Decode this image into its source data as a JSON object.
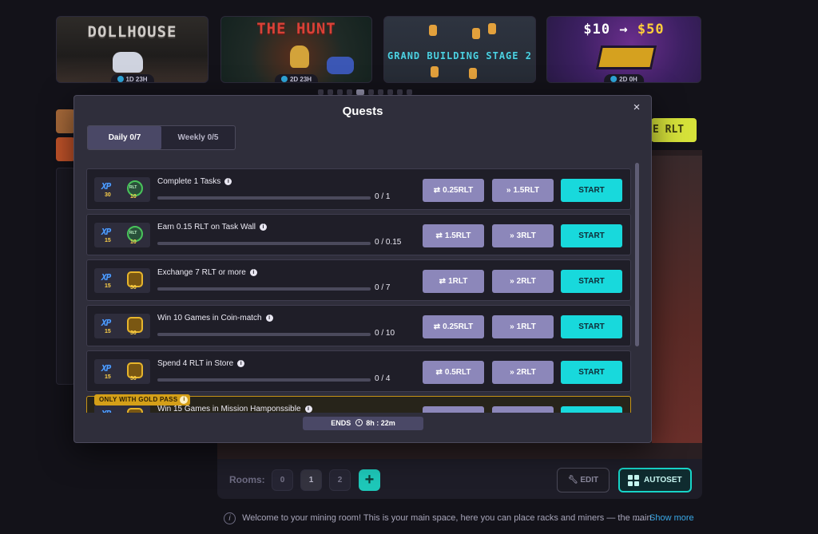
{
  "banners": [
    {
      "title": "DOLLHOUSE",
      "timer": "1D 23H"
    },
    {
      "title": "THE HUNT",
      "timer": "2D 23H"
    },
    {
      "title": "GRAND BUILDING STAGE 2",
      "timer": ""
    },
    {
      "title_left": "$10",
      "title_arrow": "→",
      "title_right": "$50",
      "timer": "2D 0H"
    }
  ],
  "side_tag": "E RLT",
  "modal": {
    "title": "Quests",
    "close_label": "×",
    "tabs": [
      {
        "label": "Daily 0/7",
        "active": true
      },
      {
        "label": "Weekly 0/5",
        "active": false
      }
    ],
    "gold_badge": "ONLY WITH GOLD PASS",
    "quests": [
      {
        "title": "Complete 1 Tasks",
        "xp": "30",
        "token": "rlt",
        "token_amount": "10",
        "progress": "0 / 1",
        "progress_fraction": 0,
        "exchange": "0.25RLT",
        "skip": "1.5RLT",
        "start": "START"
      },
      {
        "title": "Earn 0.15 RLT on Task Wall",
        "xp": "15",
        "token": "rlt",
        "token_amount": "10",
        "progress": "0 / 0.15",
        "progress_fraction": 0,
        "exchange": "1.5RLT",
        "skip": "3RLT",
        "start": "START"
      },
      {
        "title": "Exchange 7 RLT or more",
        "xp": "15",
        "token": "chest",
        "token_amount": "30",
        "progress": "0 / 7",
        "progress_fraction": 0,
        "exchange": "1RLT",
        "skip": "2RLT",
        "start": "START"
      },
      {
        "title": "Win 10 Games in Coin-match",
        "xp": "15",
        "token": "chest",
        "token_amount": "30",
        "progress": "0 / 10",
        "progress_fraction": 0,
        "exchange": "0.25RLT",
        "skip": "1RLT",
        "start": "START"
      },
      {
        "title": "Spend 4 RLT in Store",
        "xp": "15",
        "token": "chest",
        "token_amount": "30",
        "progress": "0 / 4",
        "progress_fraction": 0,
        "exchange": "0.5RLT",
        "skip": "2RLT",
        "start": "START"
      },
      {
        "title": "Win 15 Games in Mission Hamponssible",
        "xp": "",
        "token": "chest",
        "token_amount": "",
        "progress": "",
        "progress_fraction": 0,
        "exchange": "",
        "skip": "",
        "start": "",
        "gold": true
      }
    ],
    "ends_label": "ENDS",
    "ends_time": "8h : 22m"
  },
  "rooms_bar": {
    "label": "Rooms:",
    "rooms": [
      "0",
      "1",
      "2"
    ],
    "selected": "1",
    "add_label": "+",
    "edit_label": "EDIT",
    "autoset_label": "AUTOSET"
  },
  "info": {
    "icon": "i",
    "text": "Welcome to your mining room! This is your main space, here you can place racks and miners — the main",
    "ellipsis": "...",
    "show_more": "Show more"
  },
  "colors": {
    "accent": "#18d9dc",
    "secondary_button": "#8c87ba",
    "gold": "#d49f18",
    "modal_bg": "#2f2e3b"
  }
}
